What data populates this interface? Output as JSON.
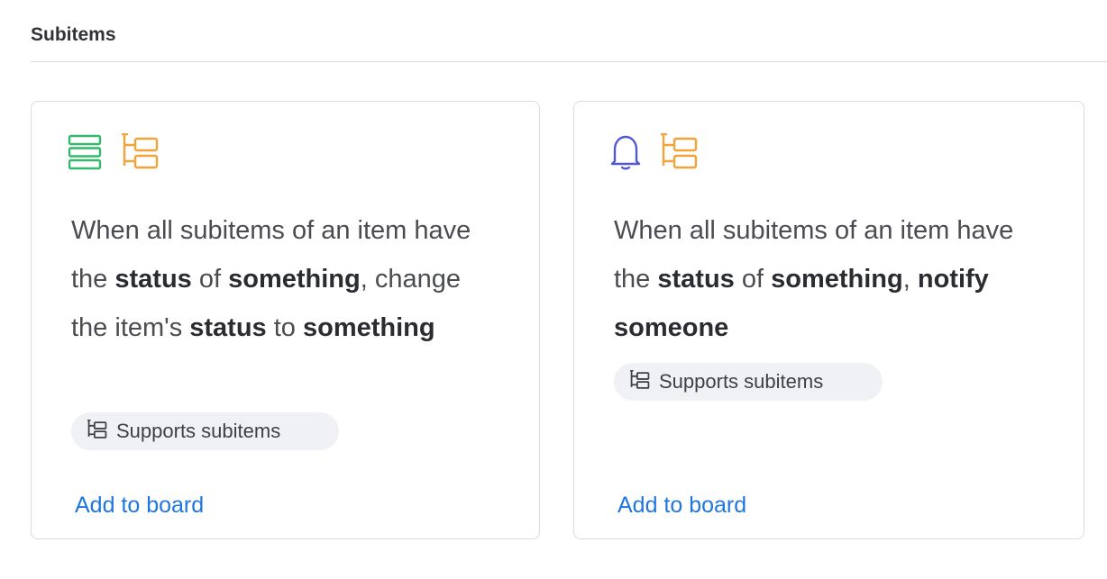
{
  "section": {
    "title": "Subitems"
  },
  "cards": [
    {
      "icons": [
        "table-rows-icon",
        "subitems-tree-icon"
      ],
      "recipe": {
        "t1": "When all subitems of an item have the ",
        "b1": "status",
        "t2": " of ",
        "b2": "something",
        "t3": ", change the item's ",
        "b3": "status",
        "t4": " to ",
        "b4": "something"
      },
      "badge_label": "Supports subitems",
      "add_label": "Add to board"
    },
    {
      "icons": [
        "bell-icon",
        "subitems-tree-icon"
      ],
      "recipe": {
        "t1": "When all subitems of an item have the ",
        "b1": "status",
        "t2": " of ",
        "b2": "something",
        "t3": ", ",
        "b3": "notify someone"
      },
      "badge_label": "Supports subitems",
      "add_label": "Add to board"
    }
  ],
  "colors": {
    "green_icon": "#33b96b",
    "orange_icon": "#f2a43a",
    "bell_icon": "#5159d8",
    "link": "#1f76dc",
    "badge_bg": "#f0f1f5"
  }
}
